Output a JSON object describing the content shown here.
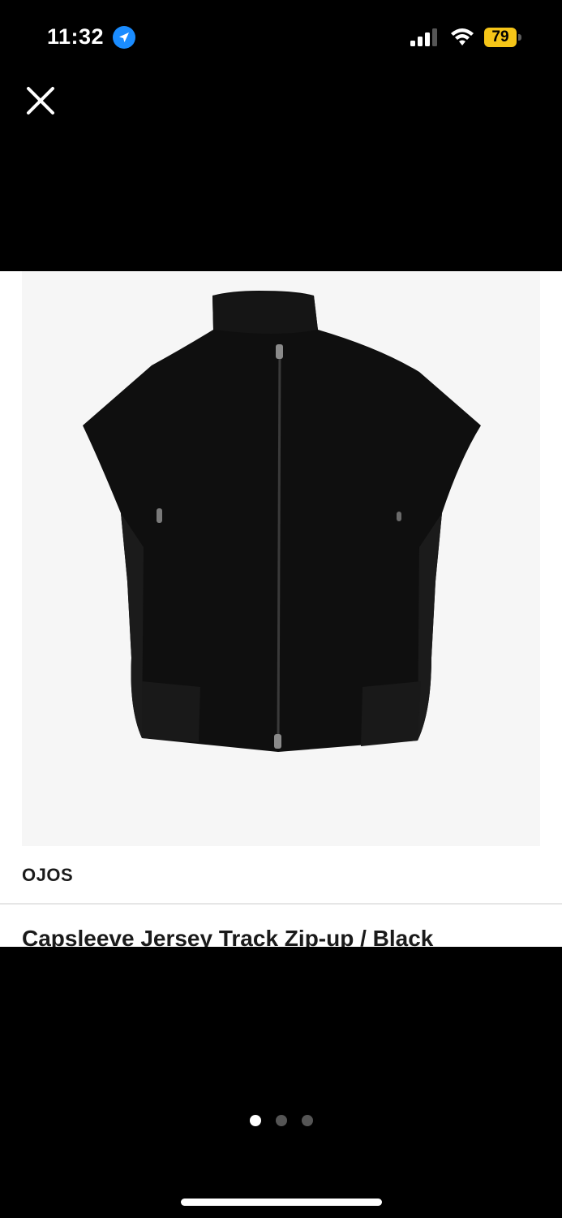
{
  "status_bar": {
    "time": "11:32",
    "battery_level": "79",
    "battery_color": "#f5c518",
    "icons": [
      "location-arrow-icon",
      "cellular-signal-icon",
      "wifi-icon",
      "battery-icon"
    ]
  },
  "viewer": {
    "close_icon": "close-icon",
    "brand": "OJOS",
    "title": "Capsleeve Jersey Track Zip-up / Black",
    "image_subject": "black capsleeve zip-up jacket",
    "pager": {
      "count": 3,
      "active_index": 0
    }
  }
}
